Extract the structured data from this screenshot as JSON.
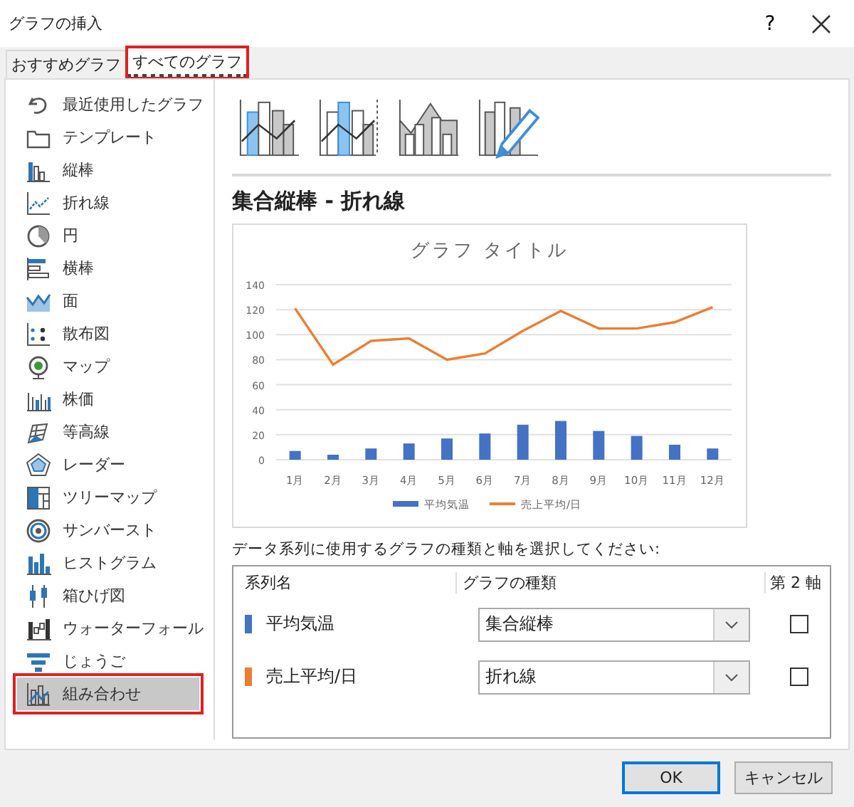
{
  "window": {
    "title": "グラフの挿入",
    "help": "?"
  },
  "tabs": [
    {
      "label": "おすすめグラフ",
      "selected": false
    },
    {
      "label": "すべてのグラフ",
      "selected": true
    }
  ],
  "sidebar": {
    "items": [
      {
        "label": "最近使用したグラフ",
        "selected": false
      },
      {
        "label": "テンプレート",
        "selected": false
      },
      {
        "label": "縦棒",
        "selected": false
      },
      {
        "label": "折れ線",
        "selected": false
      },
      {
        "label": "円",
        "selected": false
      },
      {
        "label": "横棒",
        "selected": false
      },
      {
        "label": "面",
        "selected": false
      },
      {
        "label": "散布図",
        "selected": false
      },
      {
        "label": "マップ",
        "selected": false
      },
      {
        "label": "株価",
        "selected": false
      },
      {
        "label": "等高線",
        "selected": false
      },
      {
        "label": "レーダー",
        "selected": false
      },
      {
        "label": "ツリーマップ",
        "selected": false
      },
      {
        "label": "サンバースト",
        "selected": false
      },
      {
        "label": "ヒストグラム",
        "selected": false
      },
      {
        "label": "箱ひげ図",
        "selected": false
      },
      {
        "label": "ウォーターフォール",
        "selected": false
      },
      {
        "label": "じょうご",
        "selected": false
      },
      {
        "label": "組み合わせ",
        "selected": true
      }
    ]
  },
  "heading": "集合縦棒 - 折れ線",
  "preview": {
    "chart_data": {
      "type": "bar",
      "title": "グラフ タイトル",
      "categories": [
        "1月",
        "2月",
        "3月",
        "4月",
        "5月",
        "6月",
        "7月",
        "8月",
        "9月",
        "10月",
        "11月",
        "12月"
      ],
      "ylim": [
        0,
        140
      ],
      "yticks": [
        0,
        20,
        40,
        60,
        80,
        100,
        120,
        140
      ],
      "grid": true,
      "legend": "bottom",
      "series": [
        {
          "name": "平均気温",
          "color": "#4472c4",
          "type": "bar",
          "values": [
            7,
            4,
            9,
            13,
            17,
            21,
            28,
            31,
            23,
            19,
            12,
            9
          ]
        },
        {
          "name": "売上平均/日",
          "color": "#ed7d31",
          "type": "line",
          "values": [
            121,
            76,
            95,
            97,
            80,
            85,
            103,
            119,
            105,
            105,
            110,
            122
          ]
        }
      ]
    }
  },
  "series_prompt": "データ系列に使用するグラフの種類と軸を選択してください:",
  "series_table": {
    "columns": [
      "系列名",
      "グラフの種類",
      "第 2 軸"
    ],
    "rows": [
      {
        "name": "平均気温",
        "color": "#4472c4",
        "chart_type": "集合縦棒",
        "secondary_axis": false
      },
      {
        "name": "売上平均/日",
        "color": "#ed7d31",
        "chart_type": "折れ線",
        "secondary_axis": false
      }
    ]
  },
  "buttons": [
    {
      "label": "OK",
      "default": true
    },
    {
      "label": "キャンセル",
      "default": false
    }
  ]
}
